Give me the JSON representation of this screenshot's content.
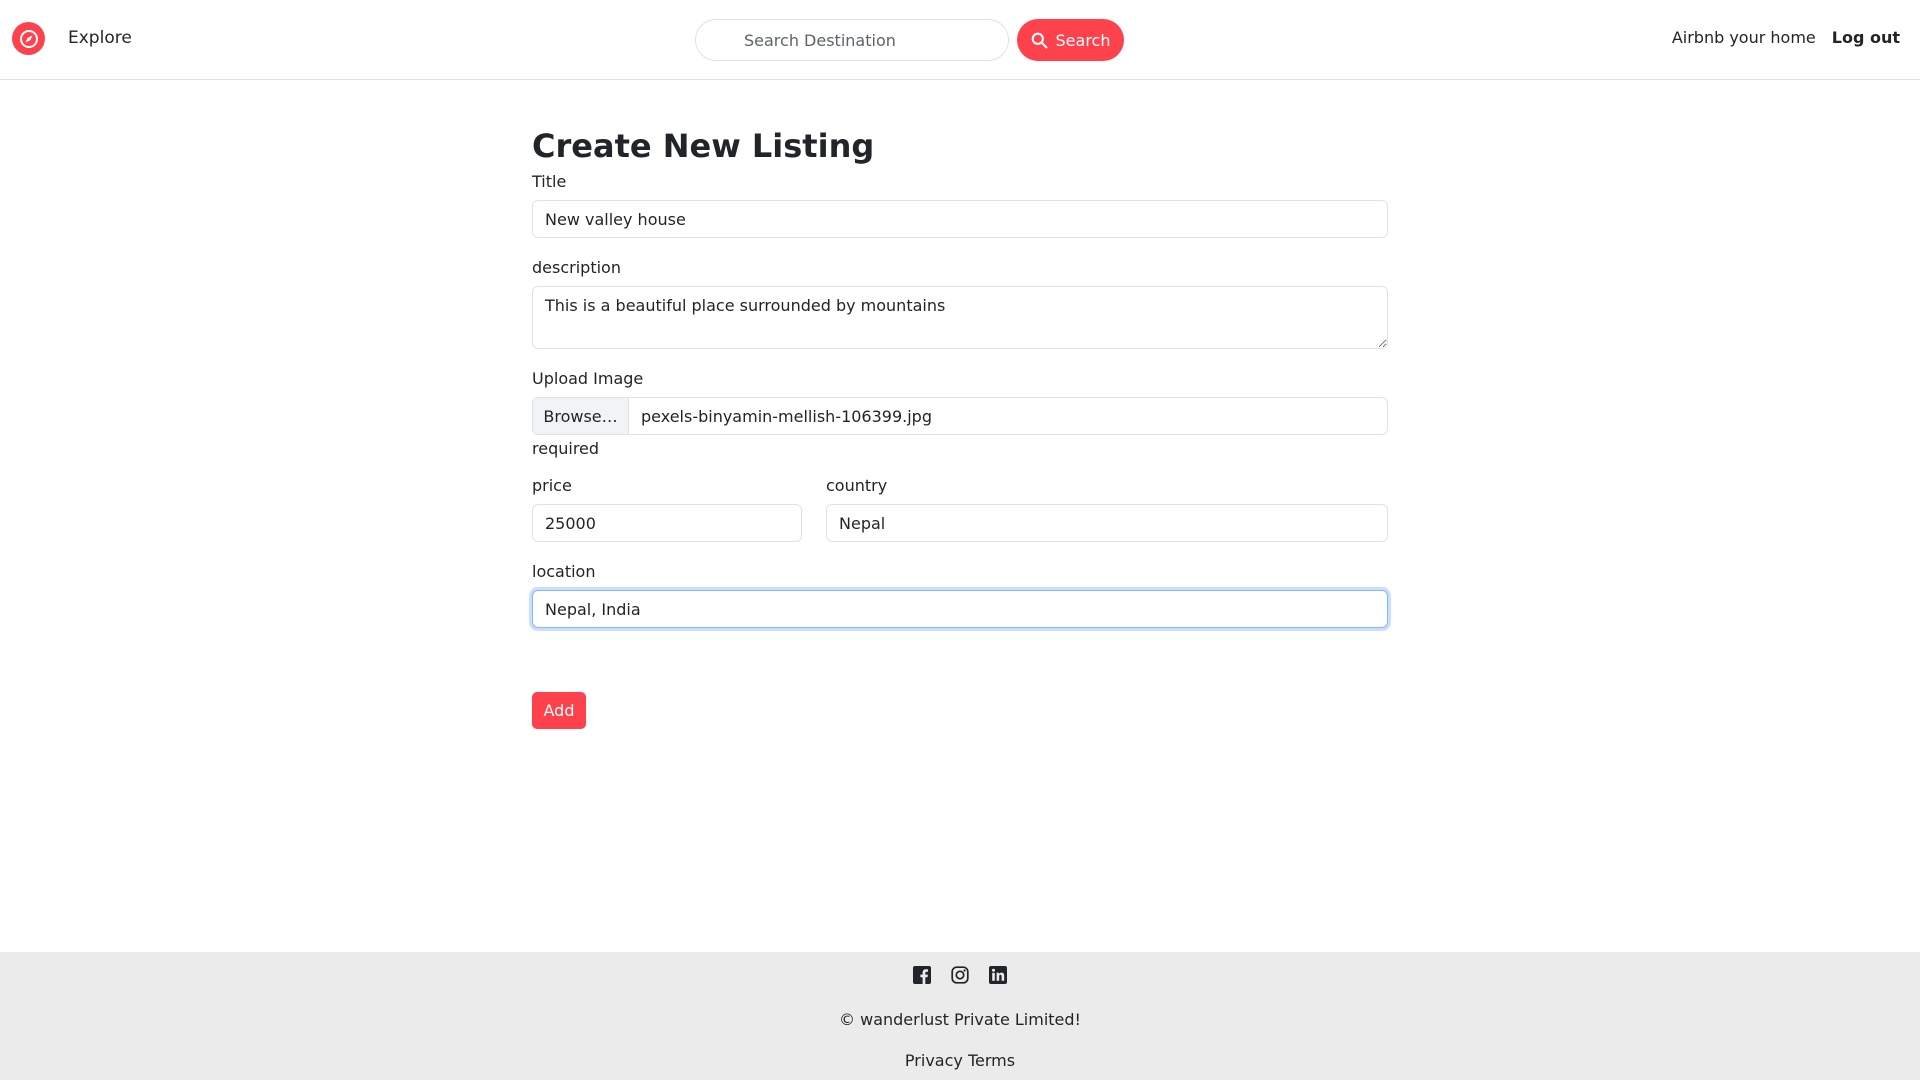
{
  "navbar": {
    "logo_icon": "compass-icon",
    "explore": "Explore",
    "search_placeholder": "Search Destination",
    "search_button": "Search",
    "host_link": "Airbnb your home",
    "logout_link": "Log out"
  },
  "form": {
    "heading": "Create New Listing",
    "title_label": "Title",
    "title_value": "New valley house",
    "description_label": "description",
    "description_value": "This is a beautiful place surrounded by mountains",
    "image_label": "Upload Image",
    "browse_label": "Browse…",
    "file_name": "pexels-binyamin-mellish-106399.jpg",
    "required_text": "required",
    "price_label": "price",
    "price_value": "25000",
    "country_label": "country",
    "country_value": "Nepal",
    "location_label": "location",
    "location_value": "Nepal, India",
    "submit_button": "Add"
  },
  "footer": {
    "social_icons": [
      "facebook-icon",
      "instagram-icon",
      "linkedin-icon"
    ],
    "copyright": "© wanderlust Private Limited!",
    "links": "Privacy Terms"
  },
  "colors": {
    "brand": "#fe424d",
    "footer_bg": "#ebebeb"
  }
}
